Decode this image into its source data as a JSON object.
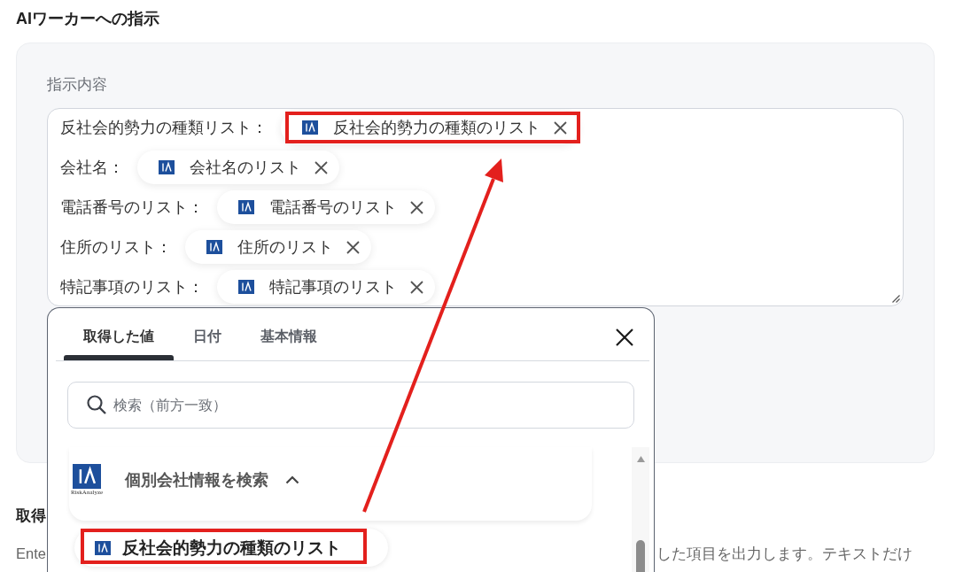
{
  "section_title": "AIワーカーへの指示",
  "instruction": {
    "label": "指示内容",
    "lines": [
      {
        "label": "反社会的勢力の種類リスト：",
        "chip": {
          "text": "反社会的勢力の種類のリスト",
          "highlighted": true
        }
      },
      {
        "label": "会社名：",
        "chip": {
          "text": "会社名のリスト",
          "highlighted": false
        }
      },
      {
        "label": "電話番号のリスト：",
        "chip": {
          "text": "電話番号のリスト",
          "highlighted": false
        }
      },
      {
        "label": "住所のリスト：",
        "chip": {
          "text": "住所のリスト",
          "highlighted": false
        }
      },
      {
        "label": "特記事項のリスト：",
        "chip": {
          "text": "特記事項のリスト",
          "highlighted": false
        }
      }
    ]
  },
  "picker": {
    "tabs": [
      {
        "label": "取得した値",
        "selected": true
      },
      {
        "label": "日付",
        "selected": false
      },
      {
        "label": "基本情報",
        "selected": false
      }
    ],
    "search": {
      "placeholder": "検索（前方一致）"
    },
    "groups": [
      {
        "title": "個別会社情報を検索",
        "logo_caption": "RiskAnalyze",
        "expanded": true,
        "items": [
          {
            "label": "反社会的勢力の種類のリスト",
            "highlighted": true
          }
        ]
      }
    ]
  },
  "next_section": {
    "title": "取得",
    "text_left": "Ente",
    "text_right": "した項目を出力します。テキストだけ"
  },
  "callout_arrow": true
}
